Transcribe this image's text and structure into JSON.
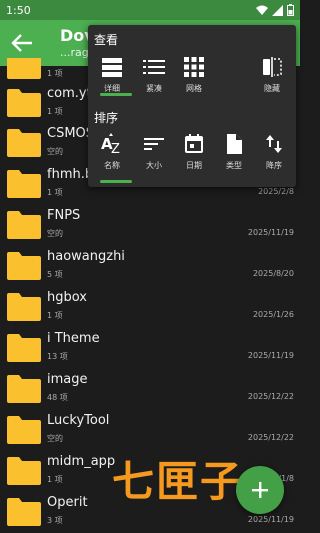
{
  "status": {
    "time": "1:50"
  },
  "toolbar": {
    "title": "Dov",
    "subtitle": "...rag"
  },
  "menu": {
    "view_header": "查看",
    "view_items": [
      {
        "label": "详细",
        "icon": "list-detail-icon",
        "active": true
      },
      {
        "label": "紧凑",
        "icon": "list-compact-icon",
        "active": false
      },
      {
        "label": "网格",
        "icon": "grid-icon",
        "active": false
      },
      {
        "label": "隐藏",
        "icon": "hide-icon",
        "active": false
      }
    ],
    "sort_header": "排序",
    "sort_items": [
      {
        "label": "名称",
        "icon": "sort-az-icon",
        "active": true
      },
      {
        "label": "大小",
        "icon": "sort-size-icon",
        "active": false
      },
      {
        "label": "日期",
        "icon": "calendar-icon",
        "active": false
      },
      {
        "label": "类型",
        "icon": "file-type-icon",
        "active": false
      },
      {
        "label": "降序",
        "icon": "sort-order-icon",
        "active": false
      }
    ]
  },
  "files": [
    {
      "name": "",
      "count": "1 项",
      "date": ""
    },
    {
      "name": "com.yt",
      "count": "1 项",
      "date": ""
    },
    {
      "name": "CSMOS",
      "count": "空的",
      "date": ""
    },
    {
      "name": "fhmh.b",
      "count": "1 项",
      "date": "2025/2/8"
    },
    {
      "name": "FNPS",
      "count": "空的",
      "date": "2025/11/19"
    },
    {
      "name": "haowangzhi",
      "count": "5 项",
      "date": "2025/8/20"
    },
    {
      "name": "hgbox",
      "count": "1 项",
      "date": "2025/1/26"
    },
    {
      "name": "i Theme",
      "count": "13 项",
      "date": "2025/11/19"
    },
    {
      "name": "image",
      "count": "48 项",
      "date": "2025/12/22"
    },
    {
      "name": "LuckyTool",
      "count": "空的",
      "date": "2025/12/22"
    },
    {
      "name": "midm_app",
      "count": "1 项",
      "date": "2025/1/8"
    },
    {
      "name": "Operit",
      "count": "3 项",
      "date": "2025/11/19"
    }
  ],
  "watermark": "七匣子",
  "colors": {
    "accent": "#4caf50",
    "status_bar": "#3b8a3f",
    "folder": "#fbc02d",
    "background": "#1c1c1c",
    "menu": "#2d2d2d"
  }
}
